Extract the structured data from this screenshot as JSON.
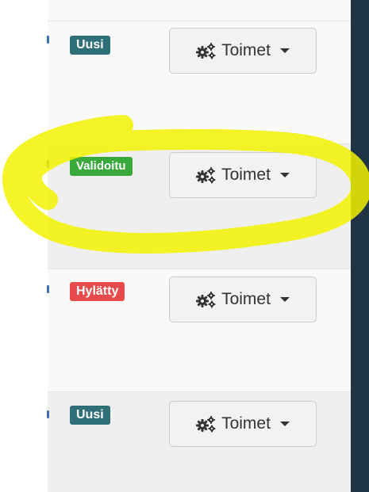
{
  "rows": [
    {
      "status": "Uusi",
      "status_color": "#2f6f78",
      "action_label": "Toimet",
      "action_icon": "gears-icon"
    },
    {
      "status": "Validoitu",
      "status_color": "#3aa93c",
      "action_label": "Toimet",
      "action_icon": "gears-icon"
    },
    {
      "status": "Hylätty",
      "status_color": "#e74a4a",
      "action_label": "Toimet",
      "action_icon": "gears-icon"
    },
    {
      "status": "Uusi",
      "status_color": "#2f6f78",
      "action_label": "Toimet",
      "action_icon": "gears-icon"
    }
  ],
  "highlight": {
    "color": "#f2f200",
    "shape": "freehand-circle"
  },
  "colors": {
    "sidebar_dark": "#1f3444",
    "row_light": "#f9f9f9",
    "row_shaded": "#efefef"
  }
}
